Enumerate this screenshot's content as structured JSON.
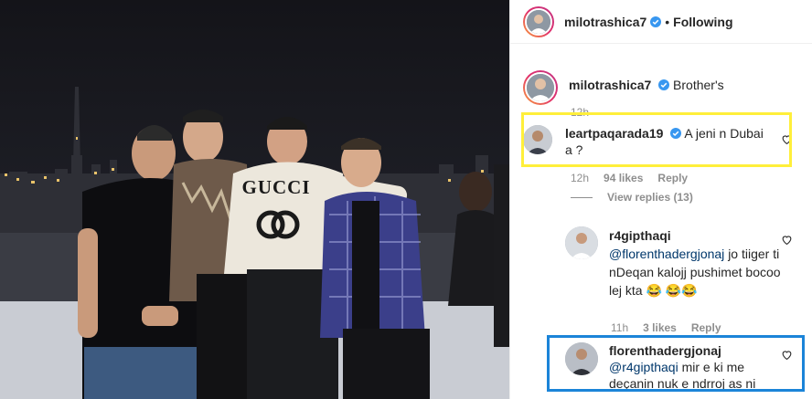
{
  "post": {
    "author": "milotrashica7",
    "follow_status": "Following",
    "separator": "•"
  },
  "caption": {
    "username": "milotrashica7",
    "text": "Brother's",
    "time": "12h"
  },
  "comments": [
    {
      "username": "leartpaqarada19",
      "verified": true,
      "text": "A jeni n Dubai a ?",
      "time": "12h",
      "likes": "94 likes",
      "reply_label": "Reply",
      "view_replies": "View replies (13)"
    }
  ],
  "replies": [
    {
      "username": "r4gipthaqi",
      "mention": "@florenthadergjonaj",
      "text": "jo tiiger ti nDeqan kalojj pushimet bocoo lej kta 😂 😂😂",
      "time": "11h",
      "likes": "3 likes",
      "reply_label": "Reply"
    },
    {
      "username": "florenthadergjonaj",
      "mention": "@r4gipthaqi",
      "text": "mir e ki me deçanin nuk e ndrroj as ni"
    }
  ],
  "photo": {
    "shirt_text": "GUCCI"
  },
  "colors": {
    "highlight_yellow": "#ffef3a",
    "highlight_blue": "#1b84d8",
    "verified_blue": "#3897f0",
    "mention_blue": "#00376b"
  }
}
